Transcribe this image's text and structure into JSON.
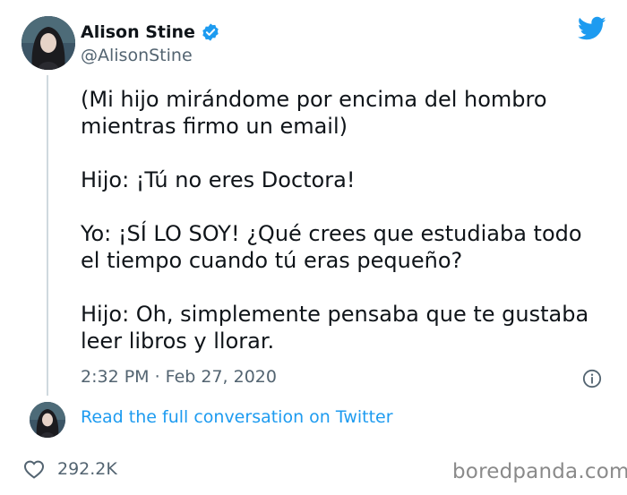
{
  "author": {
    "display_name": "Alison Stine",
    "handle": "@AlisonStine",
    "verified": true
  },
  "tweet": {
    "text": "(Mi hijo mirándome por encima del hombro\nmientras firmo un email)\n\nHijo: ¡Tú no eres Doctora!\n\nYo: ¡SÍ LO SOY! ¿Qué crees que estudiaba todo\nel tiempo cuando tú eras pequeño?\n\nHijo: Oh, simplemente pensaba que te gustaba\nleer libros y llorar.",
    "timestamp": "2:32 PM · Feb 27, 2020"
  },
  "conversation_link": "Read the full conversation on Twitter",
  "engagement": {
    "likes": "292.2K"
  },
  "watermark": "boredpanda.com",
  "colors": {
    "link": "#1d9bf0",
    "muted": "#536471",
    "text": "#0f1419"
  },
  "icons": [
    "verified-badge-icon",
    "twitter-bird-icon",
    "info-icon",
    "heart-icon"
  ]
}
